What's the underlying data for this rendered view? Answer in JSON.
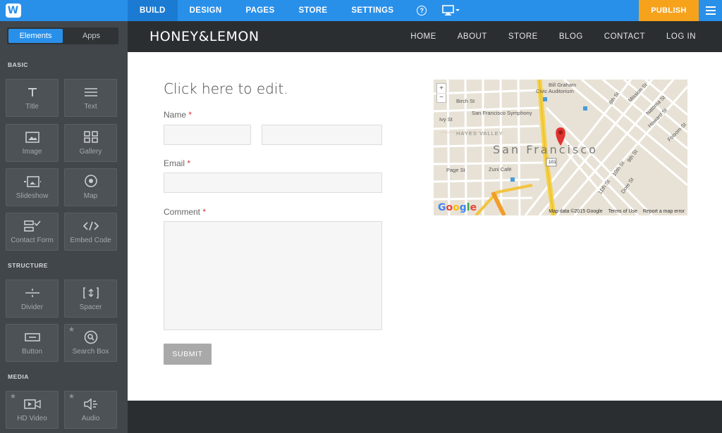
{
  "topbar": {
    "logo_letter": "W",
    "nav": [
      "BUILD",
      "DESIGN",
      "PAGES",
      "STORE",
      "SETTINGS"
    ],
    "help_label": "?",
    "publish_label": "PUBLISH"
  },
  "sidebar": {
    "tabs": [
      "Elements",
      "Apps"
    ],
    "sections": {
      "basic": "BASIC",
      "structure": "STRUCTURE",
      "media": "MEDIA"
    },
    "tiles": {
      "title": "Title",
      "text": "Text",
      "image": "Image",
      "gallery": "Gallery",
      "slideshow": "Slideshow",
      "map": "Map",
      "contact_form": "Contact Form",
      "embed_code": "Embed Code",
      "divider": "Divider",
      "spacer": "Spacer",
      "button": "Button",
      "search_box": "Search Box",
      "hd_video": "HD Video",
      "audio": "Audio"
    }
  },
  "site": {
    "brand": "HONEY&LEMON",
    "nav": [
      "HOME",
      "ABOUT",
      "STORE",
      "BLOG",
      "CONTACT",
      "LOG IN"
    ]
  },
  "form": {
    "heading": "Click here to edit.",
    "name_label": "Name",
    "email_label": "Email",
    "comment_label": "Comment",
    "required_mark": "*",
    "submit_label": "SUBMIT"
  },
  "map": {
    "city": "San Francisco",
    "labels": {
      "bill_graham": "Bill Graham",
      "civic": "Civic Auditorium",
      "birch": "Birch St",
      "symphony": "San Francisco Symphony",
      "ivy": "Ivy St",
      "hayes": "HAYES VALLEY",
      "page": "Page St",
      "zuni": "Zuni Café",
      "route": "101",
      "mission": "Mission St",
      "natoma": "Natoma St",
      "howard": "Howard St",
      "folsom": "Folsom St",
      "eighth": "8th St",
      "ninth": "9th St",
      "tenth": "10th St",
      "eleventh": "11th St",
      "dore": "Dore St"
    },
    "google": "Google",
    "footer": [
      "Map data ©2015 Google",
      "Terms of Use",
      "Report a map error"
    ]
  },
  "colors": {
    "accent": "#2990ea",
    "publish": "#f7a21b",
    "sidebar": "#41464b",
    "site_header": "#2b2e31",
    "map_pin": "#e0322f"
  }
}
